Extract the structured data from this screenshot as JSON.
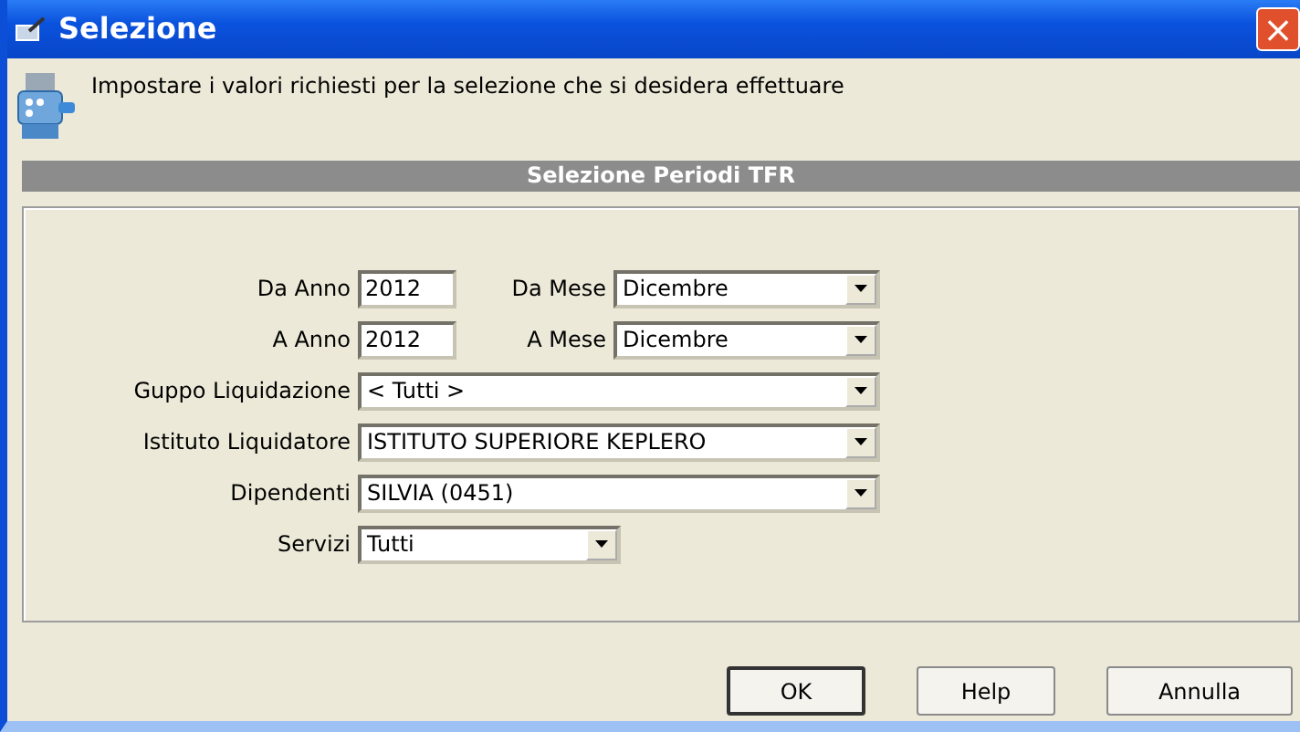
{
  "window": {
    "title": "Selezione",
    "close": "×"
  },
  "header": {
    "message": "Impostare i valori richiesti per la selezione che si desidera effettuare"
  },
  "section": {
    "title": "Selezione Periodi TFR"
  },
  "pairs": [
    {
      "label": "Da Anno",
      "value": "2012",
      "month_label": "Da Mese",
      "month": "Dicembre"
    },
    {
      "label": "A Anno",
      "value": "2012",
      "month_label": "A Mese",
      "month": "Dicembre"
    }
  ],
  "selects": [
    {
      "label": "Guppo Liquidazione",
      "value": "< Tutti >",
      "kind": "wide"
    },
    {
      "label": "Istituto Liquidatore",
      "value": "ISTITUTO SUPERIORE KEPLERO",
      "kind": "wide"
    },
    {
      "label": "Dipendenti",
      "value": "SILVIA  (0451)",
      "kind": "wide"
    },
    {
      "label": "Servizi",
      "value": "Tutti",
      "kind": "short"
    }
  ],
  "buttons": [
    {
      "label": "OK",
      "selected": true
    },
    {
      "label": "Help",
      "selected": false
    },
    {
      "label": "Annulla",
      "selected": false
    }
  ]
}
